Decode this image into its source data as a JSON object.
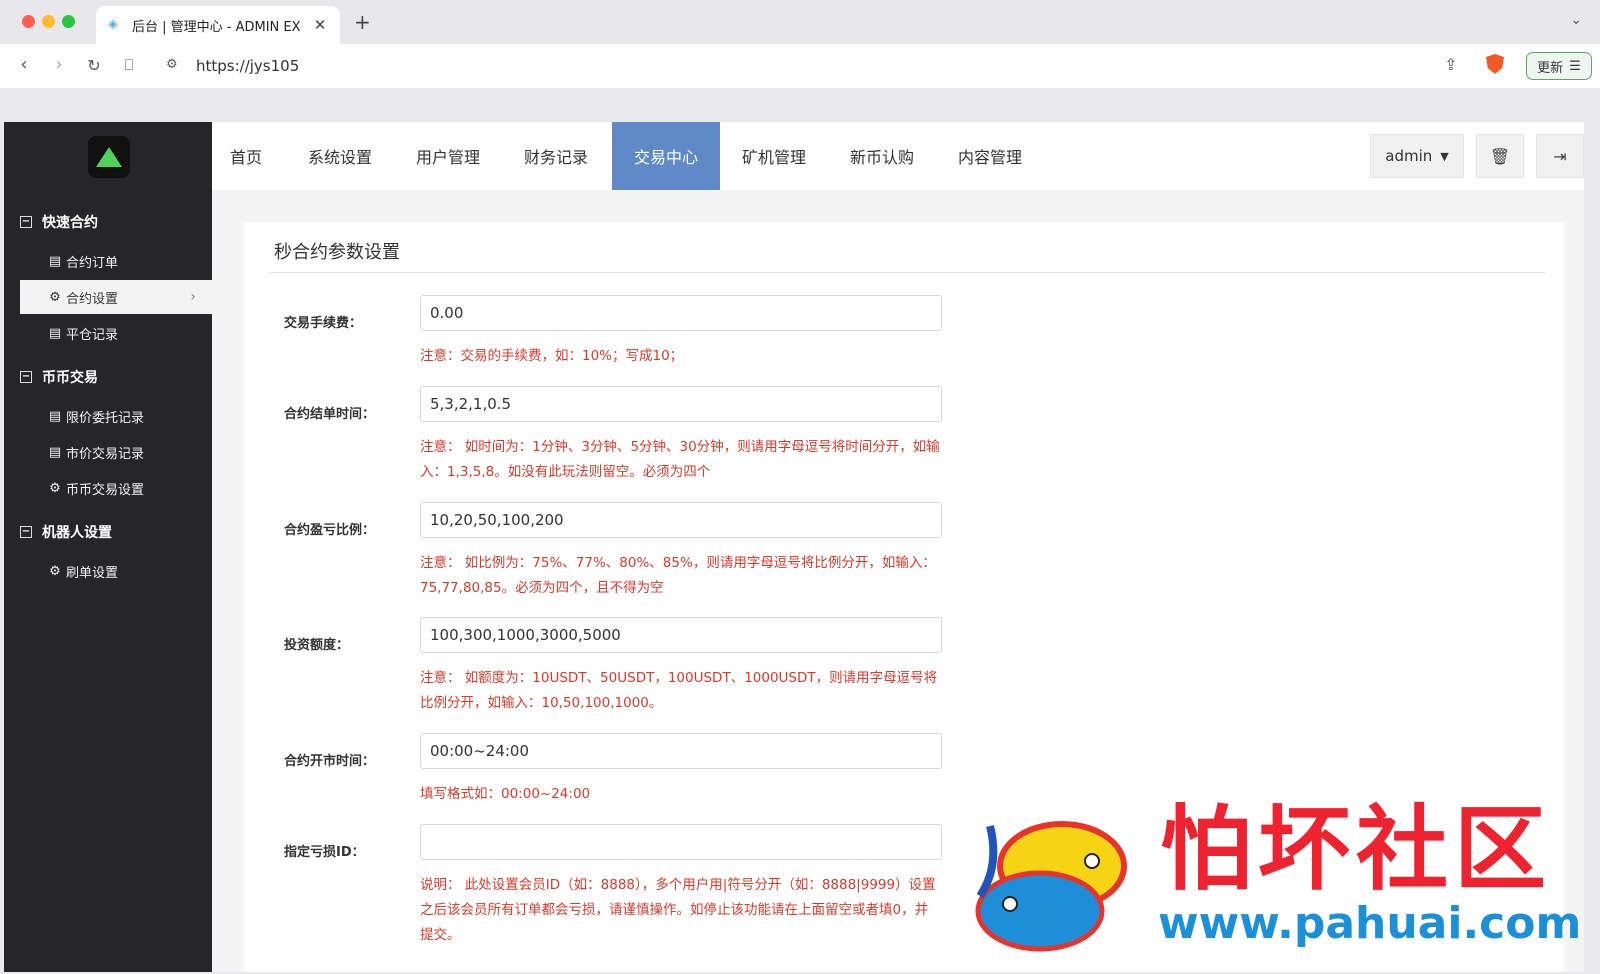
{
  "browser": {
    "tab_title": "后台 | 管理中心 - ADMIN EX",
    "url": "https://jys105",
    "update_label": "更新"
  },
  "sidebar": {
    "groups": [
      {
        "label": "快速合约",
        "items": [
          {
            "label": "合约订单",
            "icon": "list-icon"
          },
          {
            "label": "合约设置",
            "icon": "gear-icon",
            "active": true
          },
          {
            "label": "平仓记录",
            "icon": "list-icon"
          }
        ]
      },
      {
        "label": "币币交易",
        "items": [
          {
            "label": "限价委托记录",
            "icon": "list-icon"
          },
          {
            "label": "市价交易记录",
            "icon": "list-icon"
          },
          {
            "label": "币币交易设置",
            "icon": "gear-icon"
          }
        ]
      },
      {
        "label": "机器人设置",
        "items": [
          {
            "label": "刷单设置",
            "icon": "gear-icon"
          }
        ]
      }
    ]
  },
  "topnav": {
    "tabs": [
      "首页",
      "系统设置",
      "用户管理",
      "财务记录",
      "交易中心",
      "矿机管理",
      "新币认购",
      "内容管理"
    ],
    "active_tab": "交易中心",
    "user": "admin"
  },
  "form": {
    "title": "秒合约参数设置",
    "fields": [
      {
        "label": "交易手续费：",
        "value": "0.00",
        "note": "注意：交易的手续费，如：10%；写成10；"
      },
      {
        "label": "合约结单时间：",
        "value": "5,3,2,1,0.5",
        "note": "注意： 如时间为：1分钟、3分钟、5分钟、30分钟，则请用字母逗号将时间分开，如输入：1,3,5,8。如没有此玩法则留空。必须为四个"
      },
      {
        "label": "合约盈亏比例：",
        "value": "10,20,50,100,200",
        "note": "注意： 如比例为：75%、77%、80%、85%，则请用字母逗号将比例分开，如输入：75,77,80,85。必须为四个，且不得为空"
      },
      {
        "label": "投资额度：",
        "value": "100,300,1000,3000,5000",
        "note": "注意： 如额度为：10USDT、50USDT，100USDT、1000USDT，则请用字母逗号将比例分开，如输入：10,50,100,1000。"
      },
      {
        "label": "合约开市时间：",
        "value": "00:00~24:00",
        "note": "填写格式如：00:00~24:00"
      },
      {
        "label": "指定亏损ID：",
        "value": "",
        "note": "说明： 此处设置会员ID（如：8888），多个用户用|符号分开（如：8888|9999）设置之后该会员所有订单都会亏损，请谨慎操作。如停止该功能请在上面留空或者填0，并提交。"
      }
    ]
  },
  "watermark": {
    "title": "怕坏社区",
    "url": "www.pahuai.com"
  }
}
